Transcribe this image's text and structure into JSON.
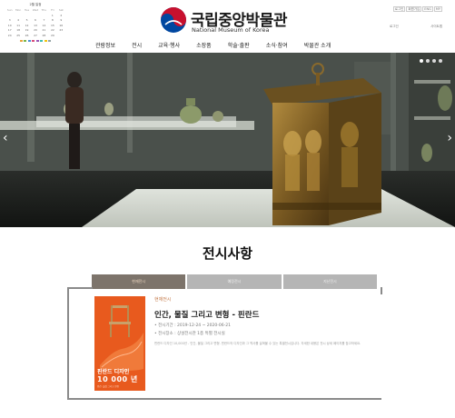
{
  "calendar": {
    "title": "2월 일정",
    "weekdays": [
      "Sun",
      "Mon",
      "Tue",
      "Wed",
      "Thu",
      "Fri",
      "Sat"
    ],
    "days": [
      "",
      "",
      "",
      "",
      "",
      "1",
      "2",
      "3",
      "4",
      "5",
      "6",
      "7",
      "8",
      "9",
      "10",
      "11",
      "12",
      "13",
      "14",
      "15",
      "16",
      "17",
      "18",
      "19",
      "20",
      "21",
      "22",
      "23",
      "24",
      "25",
      "26",
      "27",
      "28",
      "29",
      ""
    ],
    "legend_colors": [
      "#e8a33d",
      "#7ab648",
      "#4a90d9",
      "#d94a7a",
      "#9b59b6",
      "#3dbfb3",
      "#f1c40f",
      "#95a5a6"
    ]
  },
  "logo": {
    "korean": "국립중앙박물관",
    "english": "National Museum of Korea",
    "emblem_colors": [
      "#c8102e",
      "#0047a0"
    ]
  },
  "utility": {
    "links": [
      "로그인",
      "회원가입",
      "ENG",
      "MY"
    ],
    "left_label": "로그인",
    "right_label": "사이트맵"
  },
  "gnb": {
    "items": [
      "관람정보",
      "전시",
      "교육·행사",
      "소장품",
      "학술·출판",
      "소식·참여",
      "박물관 소개"
    ]
  },
  "hero": {
    "prev_label": "‹",
    "next_label": "›",
    "slide_count": 4,
    "active_slide": 1
  },
  "exhibition": {
    "section_title": "전시사항",
    "tabs": [
      "현재전시",
      "예정전시",
      "지난전시"
    ],
    "active_tab": 0,
    "item": {
      "category": "현재전시",
      "title": "인간, 물질 그리고 변형 - 핀란드",
      "period": "• 전시기간 : 2019-12-24 ~ 2020-06-21",
      "venue": "• 전시장소 : 상설전시관 1층 특별 전시실",
      "description": "핀란드 디자인 10,000년 - 인간, 물질 그리고 변형. 핀란드의 디자인과 그 역사를 살펴볼 수 있는 특별전시입니다. 자세한 내용은 전시 상세 페이지를 참고하세요.",
      "poster": {
        "title": "핀란드 디자인",
        "price": "10 000 년",
        "caption": "인간, 물질 그리고 변형"
      }
    }
  },
  "colors": {
    "tab_active": "#7d746b",
    "tab_inactive": "#b5b5b5",
    "poster_orange": "#e85a1e",
    "category_text": "#c47a4a"
  }
}
